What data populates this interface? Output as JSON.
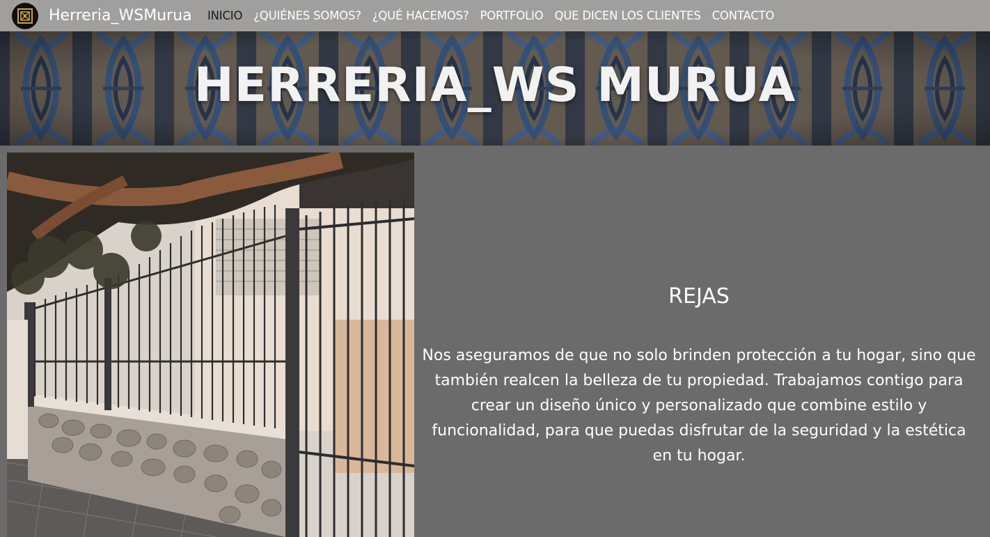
{
  "brand": {
    "logo_icon": "ornamental-square-logo",
    "name": "Herreria_WSMurua"
  },
  "nav": {
    "items": [
      {
        "label": "INICIO",
        "active": true
      },
      {
        "label": "¿QUIÉNES SOMOS?",
        "active": false
      },
      {
        "label": "¿QUÉ HACEMOS?",
        "active": false
      },
      {
        "label": "PORTFOLIO",
        "active": false
      },
      {
        "label": "QUE DICEN LOS CLIENTES",
        "active": false
      },
      {
        "label": "CONTACTO",
        "active": false
      }
    ]
  },
  "hero": {
    "title": "HERRERIA_WS MURUA"
  },
  "section": {
    "title": "REJAS",
    "body": "Nos aseguramos de que no solo brinden protección a tu hogar, sino que también realcen la belleza de tu propiedad. Trabajamos contigo para crear un diseño único y personalizado que combine estilo y funcionalidad, para que puedas disfrutar de la seguridad y la estética en tu hogar."
  },
  "colors": {
    "navbar_bg": "#a19f9d",
    "page_bg": "#6b6b6b",
    "active_nav": "#1a1a1a",
    "logo_gold": "#c9a54a"
  }
}
